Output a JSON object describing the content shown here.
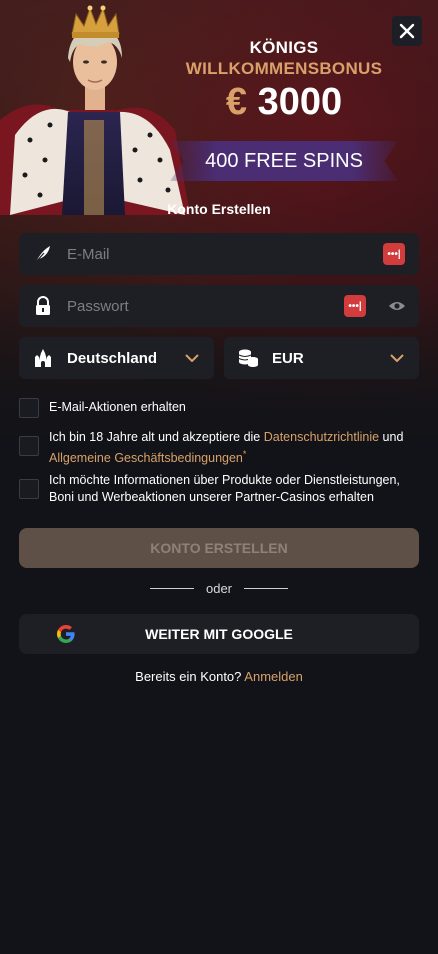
{
  "colors": {
    "accent": "#d9a169",
    "background": "#121318",
    "field": "#1e1f25",
    "badge_red": "#d23c3c",
    "spins_purple": "#4a2d72"
  },
  "bonus": {
    "line1": "KÖNIGS",
    "line2": "WILLKOMMENSBONUS",
    "currency": "€",
    "amount": "3000",
    "spins": "400 FREE SPINS"
  },
  "form": {
    "title": "Konto Erstellen",
    "email_placeholder": "E-Mail",
    "password_placeholder": "Passwort",
    "country": "Deutschland",
    "currency": "EUR",
    "checkbox_promo": "E-Mail-Aktionen erhalten",
    "checkbox_terms_prefix": "Ich bin 18 Jahre alt und akzeptiere die ",
    "terms_link_privacy": "Datenschutzrichtlinie",
    "terms_and": " und ",
    "terms_link_conditions": "Allgemeine Geschäftsbedingungen",
    "terms_required": "*",
    "checkbox_partners": "Ich möchte Informationen über Produkte oder Dienstleistungen, Boni und Werbeaktionen unserer Partner-Casinos erhalten",
    "submit_label": "KONTO ERSTELLEN",
    "divider_label": "oder",
    "google_label": "WEITER MIT GOOGLE",
    "login_prompt": "Bereits ein Konto?",
    "login_link": "Anmelden"
  },
  "icons": {
    "close": "close-icon",
    "email": "feather-icon",
    "password": "lock-icon",
    "password_generator": "password-dots-icon",
    "visibility": "eye-icon",
    "country": "castle-icon",
    "currency": "coins-icon",
    "dropdown": "chevron-down-icon",
    "google": "google-icon"
  }
}
